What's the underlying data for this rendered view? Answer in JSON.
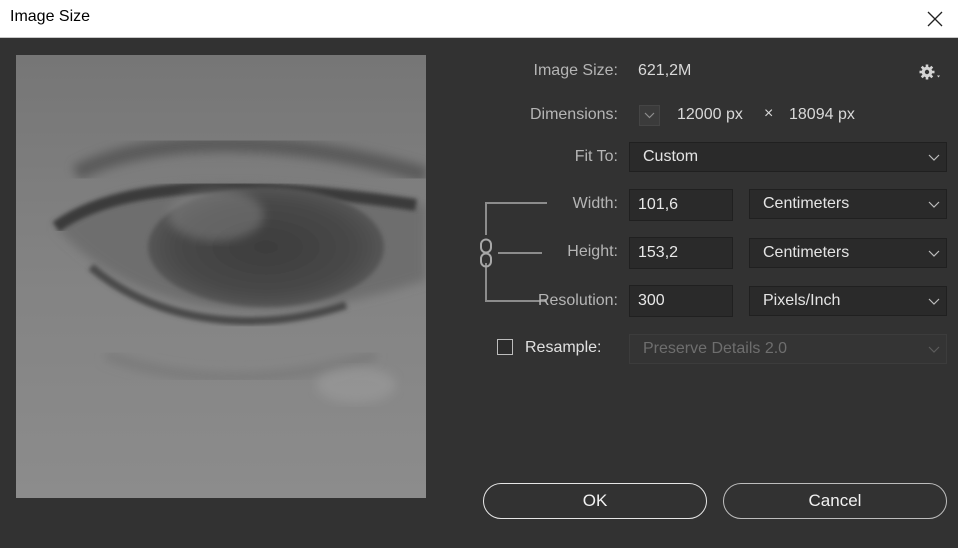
{
  "window": {
    "title": "Image Size"
  },
  "colors": {
    "background": "#323232",
    "titlebar": "#ffffff",
    "field": "#2a2a2a",
    "text": "#d9d9d9",
    "label": "#b5b5b5"
  },
  "info": {
    "image_size_label": "Image Size:",
    "image_size_value": "621,2M",
    "dimensions_label": "Dimensions:",
    "dimensions_width": "12000 px",
    "dimensions_times": "×",
    "dimensions_height": "18094 px"
  },
  "fit_to": {
    "label": "Fit To:",
    "value": "Custom"
  },
  "width": {
    "label": "Width:",
    "value": "101,6",
    "unit": "Centimeters"
  },
  "height": {
    "label": "Height:",
    "value": "153,2",
    "unit": "Centimeters"
  },
  "resolution": {
    "label": "Resolution:",
    "value": "300",
    "unit": "Pixels/Inch"
  },
  "resample": {
    "label": "Resample:",
    "checked": false,
    "method": "Preserve Details 2.0"
  },
  "buttons": {
    "ok": "OK",
    "cancel": "Cancel"
  },
  "icons": {
    "settings": "gear-icon",
    "close": "close-icon",
    "link": "chain-link-icon"
  }
}
